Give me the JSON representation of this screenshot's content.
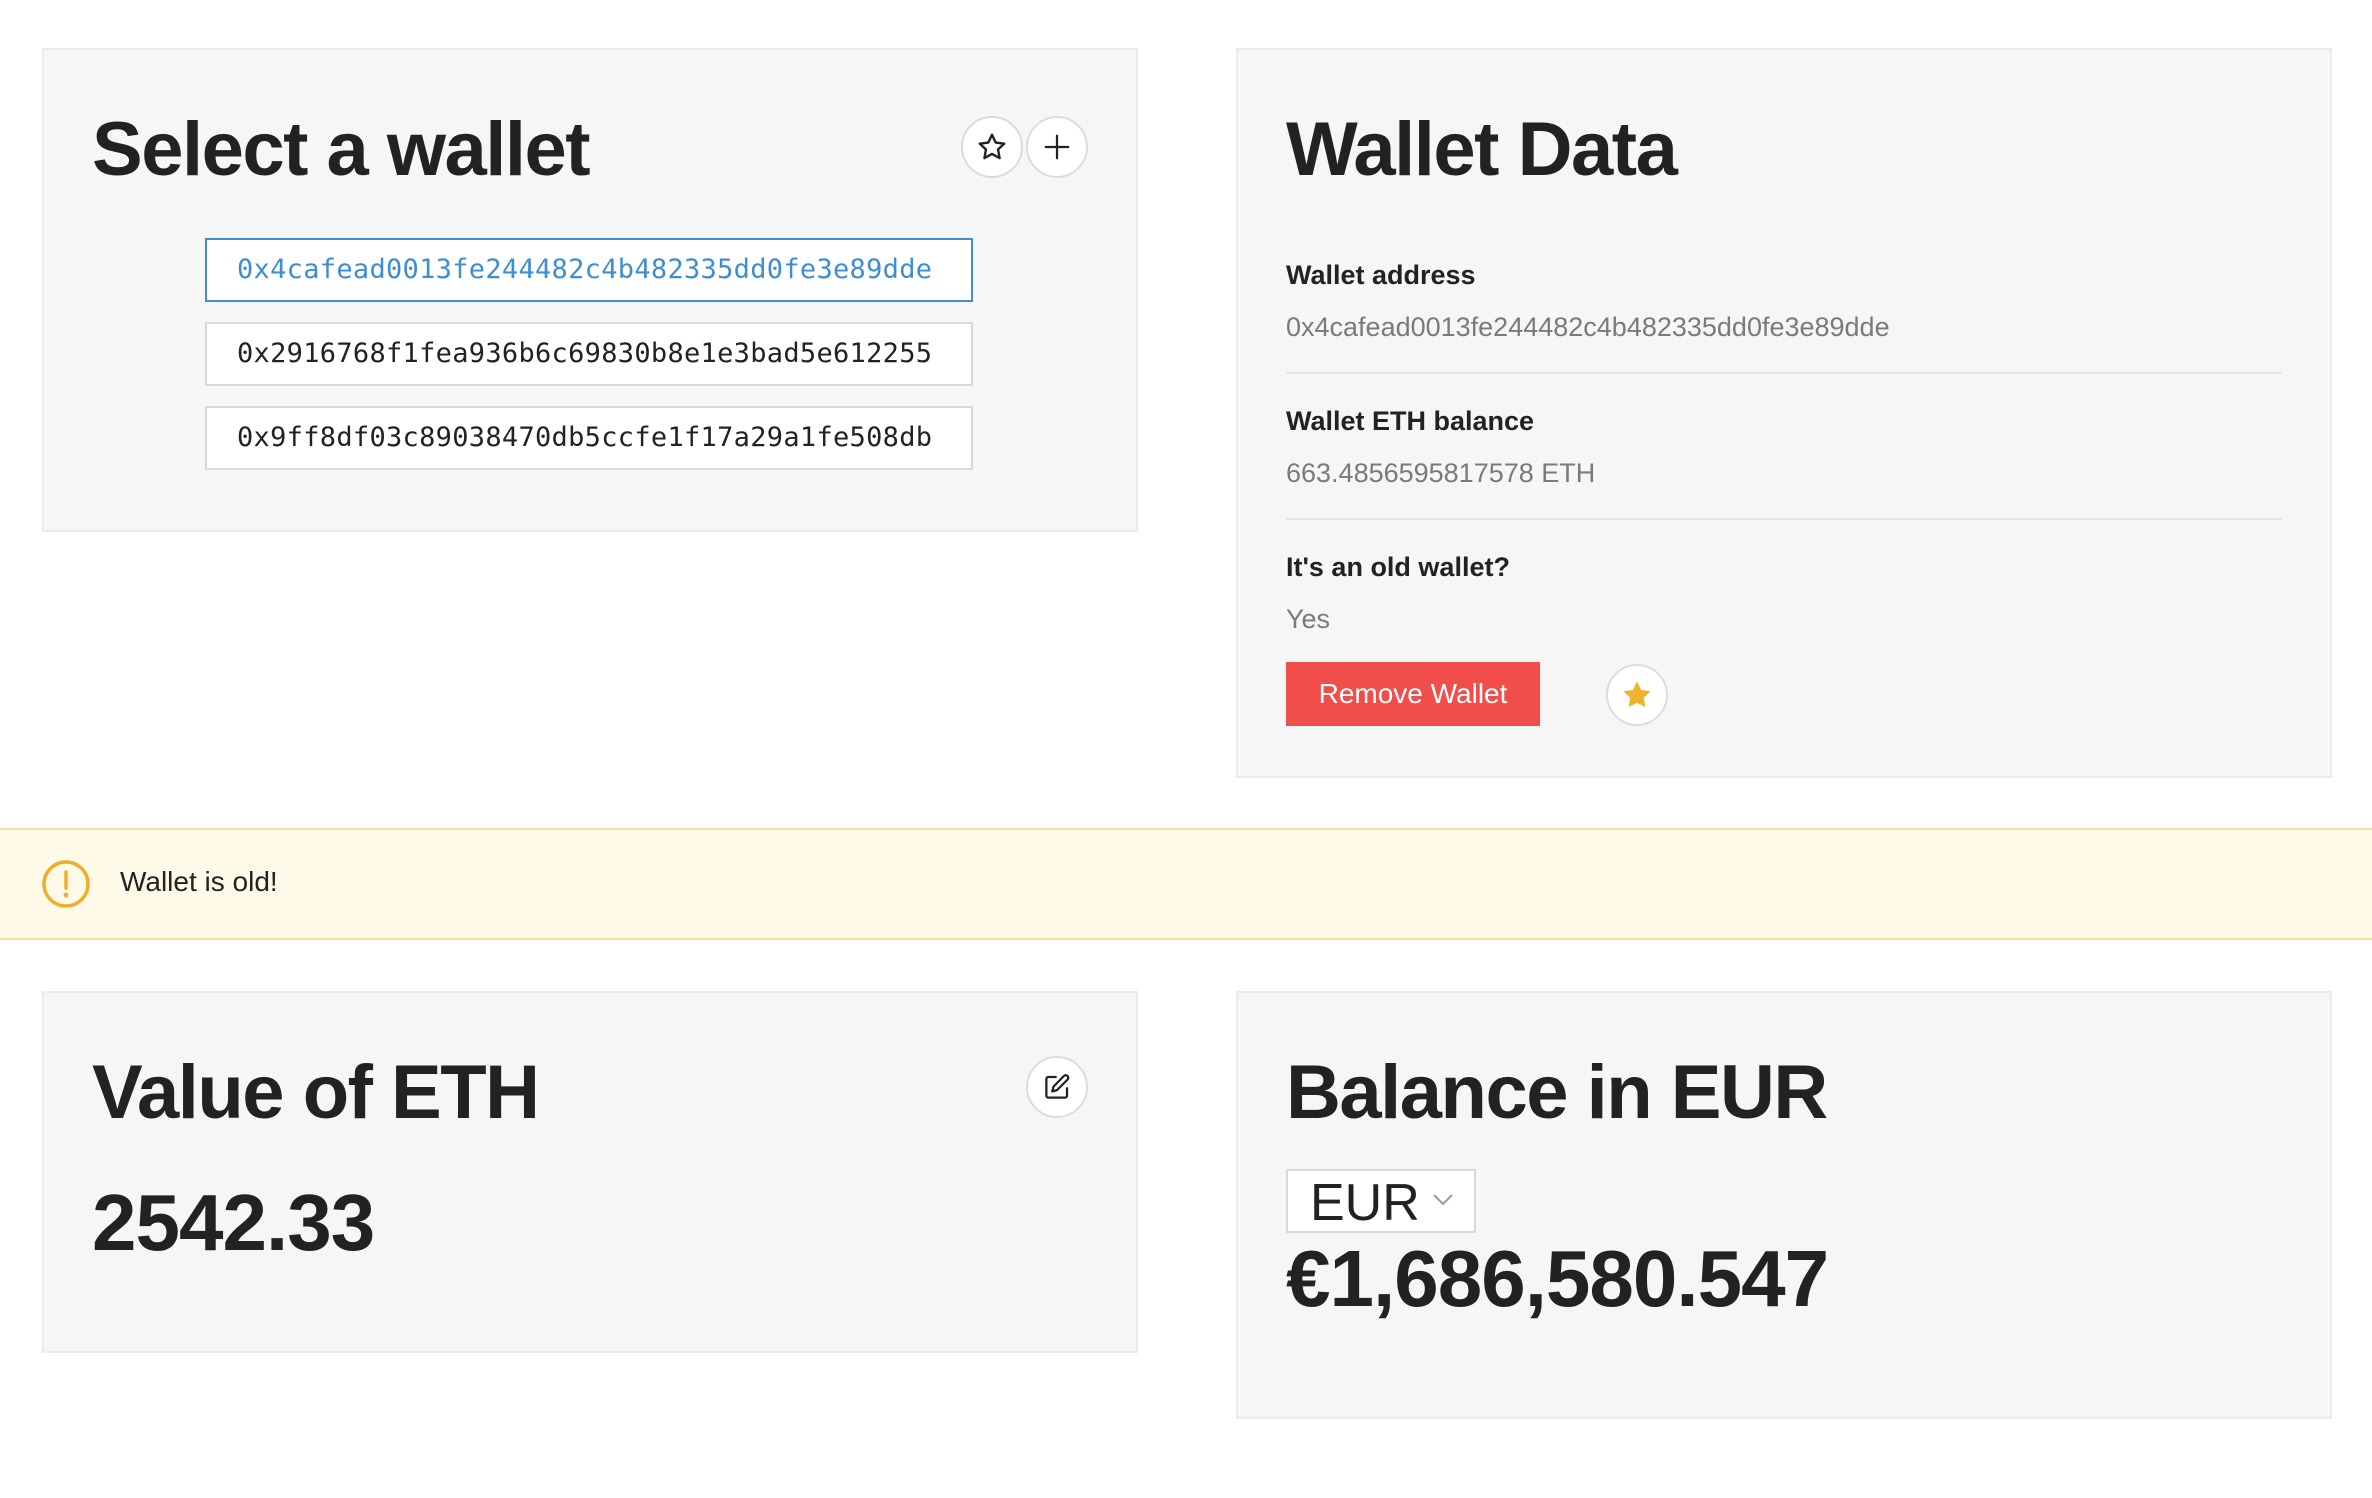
{
  "select_wallet": {
    "title": "Select a wallet",
    "favorites_icon": "star-outline-icon",
    "add_icon": "plus-icon",
    "wallets": [
      {
        "address": "0x4cafead0013fe244482c4b482335dd0fe3e89dde",
        "selected": true
      },
      {
        "address": "0x2916768f1fea936b6c69830b8e1e3bad5e612255",
        "selected": false
      },
      {
        "address": "0x9ff8df03c89038470db5ccfe1f17a29a1fe508db",
        "selected": false
      }
    ]
  },
  "wallet_data": {
    "title": "Wallet Data",
    "address_label": "Wallet address",
    "address_value": "0x4cafead0013fe244482c4b482335dd0fe3e89dde",
    "balance_label": "Wallet ETH balance",
    "balance_value": "663.4856595817578 ETH",
    "old_label": "It's an old wallet?",
    "old_value": "Yes",
    "remove_label": "Remove Wallet",
    "favorite_icon": "star-filled-icon"
  },
  "banner": {
    "icon": "warning-circle-icon",
    "text": "Wallet is old!"
  },
  "eth_value": {
    "title": "Value of ETH",
    "edit_icon": "edit-icon",
    "value": "2542.33"
  },
  "balance_eur": {
    "title": "Balance in EUR",
    "currency_selected": "EUR",
    "value": "€1,686,580.547"
  },
  "colors": {
    "accent_blue": "#3e8ed0",
    "danger_red": "#f14d4b",
    "star_gold": "#f0b32c",
    "warning_bg": "#fffae7",
    "warning_icon": "#f0ad2c"
  }
}
